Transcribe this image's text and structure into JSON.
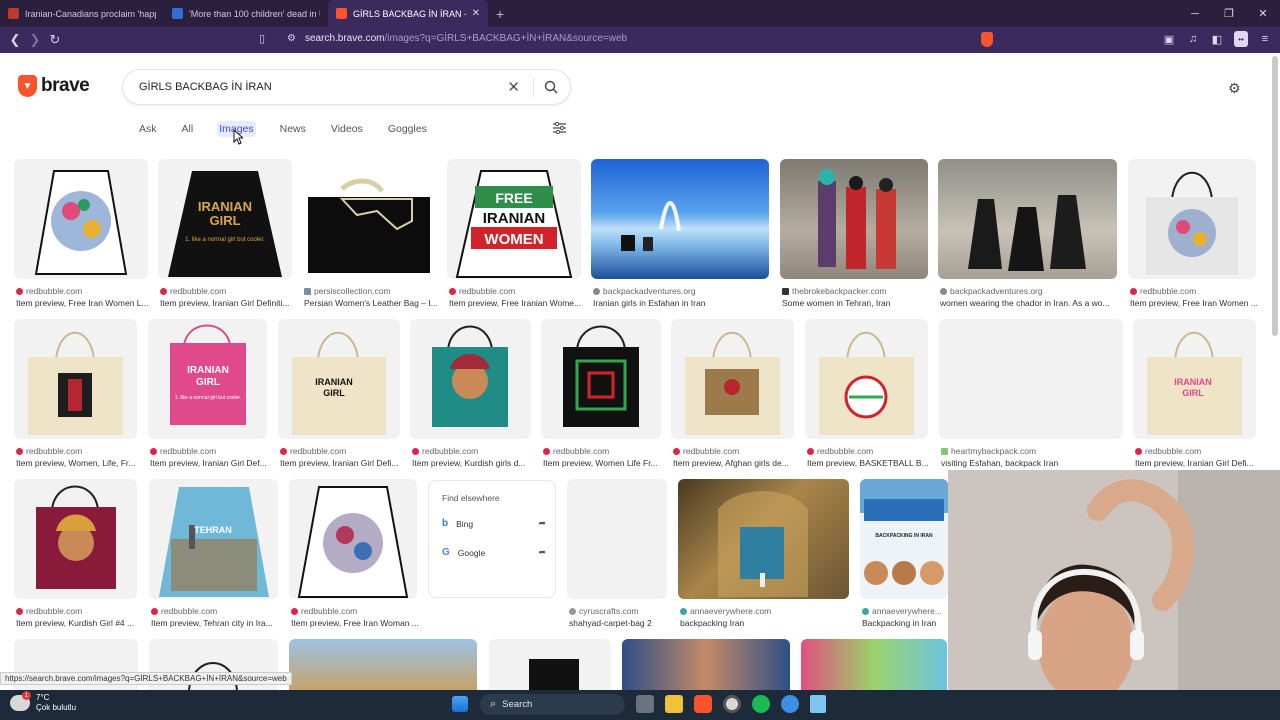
{
  "browser": {
    "tabs": [
      {
        "title": "Iranian-Canadians proclaim 'happies",
        "active": false,
        "favicon_color": "#c0392b"
      },
      {
        "title": "'More than 100 children' dead in US",
        "active": false,
        "favicon_color": "#2f6fd6"
      },
      {
        "title": "GİRLS BACKBAG İN İRAN - Brave",
        "active": true,
        "favicon_color": "#fb542b"
      }
    ],
    "url_host": "search.brave.com",
    "url_path": "/images?q=GİRLS+BACKBAG+İN+İRAN&source=web"
  },
  "search": {
    "logo_text": "brave",
    "query": "GİRLS BACKBAG İN İRAN",
    "tabs": [
      {
        "label": "Ask",
        "active": false
      },
      {
        "label": "All",
        "active": false
      },
      {
        "label": "Images",
        "active": true
      },
      {
        "label": "News",
        "active": false
      },
      {
        "label": "Videos",
        "active": false
      },
      {
        "label": "Goggles",
        "active": false
      }
    ]
  },
  "results": [
    {
      "source": "redbubble.com",
      "caption": "Item preview, Free Iran Women L..."
    },
    {
      "source": "redbubble.com",
      "caption": "Item preview, Iranian Girl Definiti..."
    },
    {
      "source": "persiscollection.com",
      "caption": "Persian Women's Leather Bag – I..."
    },
    {
      "source": "redbubble.com",
      "caption": "Item preview, Free Iranian Wome..."
    },
    {
      "source": "backpackadventures.org",
      "caption": "Iranian girls in Esfahan in Iran"
    },
    {
      "source": "thebrokebackpacker.com",
      "caption": "Some women in Tehran, Iran"
    },
    {
      "source": "backpackadventures.org",
      "caption": "women wearing the chador in Iran. As a wo..."
    },
    {
      "source": "redbubble.com",
      "caption": "Item preview, Free Iran Women ..."
    },
    {
      "source": "redbubble.com",
      "caption": "Item preview, Women, Life, Fr..."
    },
    {
      "source": "redbubble.com",
      "caption": "Item preview, Iranian Girl Def..."
    },
    {
      "source": "redbubble.com",
      "caption": "Item preview, Iranian Girl Defi..."
    },
    {
      "source": "redbubble.com",
      "caption": "Item preview, Kurdish girls d..."
    },
    {
      "source": "redbubble.com",
      "caption": "Item preview, Women Life Fr..."
    },
    {
      "source": "redbubble.com",
      "caption": "Item preview, Afghan girls de..."
    },
    {
      "source": "redbubble.com",
      "caption": "Item preview, BASKETBALL B..."
    },
    {
      "source": "heartmybackpack.com",
      "caption": "visiting Esfahan, backpack Iran"
    },
    {
      "source": "redbubble.com",
      "caption": "Item preview, Iranian Girl Defi..."
    },
    {
      "source": "redbubble.com",
      "caption": "Item preview, Kurdish Girl #4 ..."
    },
    {
      "source": "redbubble.com",
      "caption": "Item preview, Tehran city in Ira..."
    },
    {
      "source": "redbubble.com",
      "caption": "Item preview, Free Iran Woman ..."
    },
    {
      "source": "cyruscrafts.com",
      "caption": "shahyad-carpet-bag 2"
    },
    {
      "source": "annaeverywhere.com",
      "caption": "backpacking Iran"
    },
    {
      "source": "annaeverywhere...",
      "caption": "Backpacking in Iran"
    }
  ],
  "find_elsewhere": {
    "heading": "Find elsewhere",
    "engines": [
      "Bing",
      "Google"
    ]
  },
  "status_url": "https://search.brave.com/images?q=GİRLS+BACKBAG+İN+İRAN&source=web",
  "taskbar": {
    "temp": "7°C",
    "weather": "Çok bulutlu",
    "search_placeholder": "Search",
    "badge": "1"
  },
  "image_text": {
    "bag2_line1": "IRANIAN",
    "bag2_line2": "GIRL",
    "bag2_line3": "1. like a normal girl but cooler.",
    "bag4_line1": "FREE",
    "bag4_line2": "IRANIAN",
    "bag4_line3": "WOMEN",
    "pink_line1": "IRANIAN",
    "pink_line2": "GIRL",
    "pink_line3": "1. like a normal girl but cooler.",
    "tehran": "TEHRAN",
    "backpacking": "BACKPACKING IN IRAN"
  },
  "colors": {
    "accent": "#3b4fd6",
    "brand": "#fb542b"
  }
}
